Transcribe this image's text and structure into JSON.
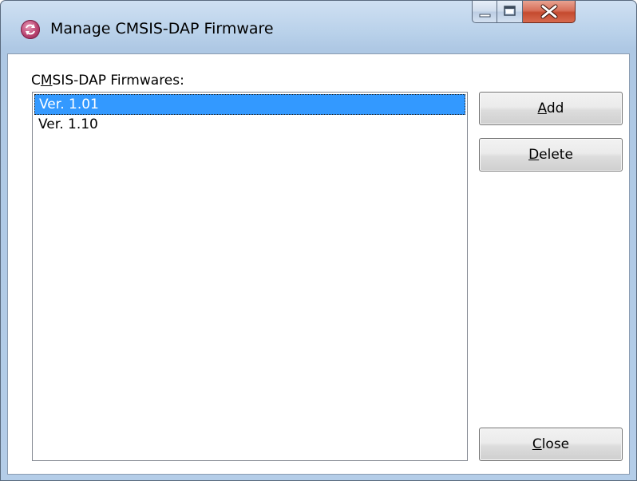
{
  "window": {
    "title": "Manage CMSIS-DAP Firmware",
    "icon": "refresh-circle-icon"
  },
  "caption_buttons": {
    "minimize_icon": "minimize-icon",
    "maximize_icon": "maximize-icon",
    "close_icon": "close-icon"
  },
  "list": {
    "label_prefix": "C",
    "label_accel": "M",
    "label_rest": "SIS-DAP Firmwares:",
    "items": [
      {
        "label": "Ver. 1.01",
        "selected": true
      },
      {
        "label": "Ver. 1.10",
        "selected": false
      }
    ]
  },
  "buttons": {
    "add": {
      "accel": "A",
      "rest": "dd"
    },
    "delete": {
      "accel": "D",
      "rest": "elete"
    },
    "close": {
      "accel": "C",
      "rest": "lose"
    }
  },
  "colors": {
    "selection": "#3399ff",
    "close_button": "#c44a2f"
  }
}
